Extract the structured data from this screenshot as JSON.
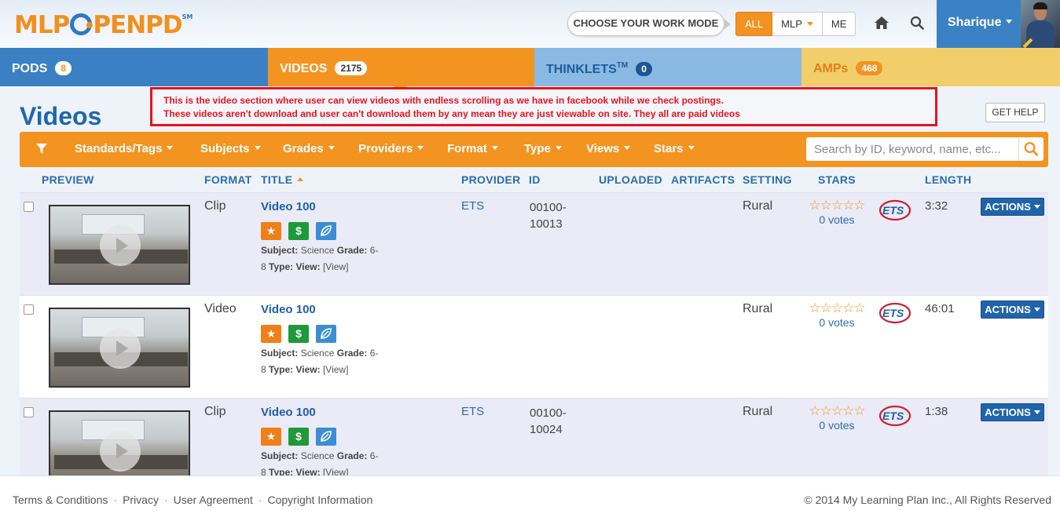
{
  "header": {
    "logo_part1": "MLP",
    "logo_part2": "PENPD",
    "logo_sm": "SM",
    "work_mode_label": "CHOOSE YOUR WORK MODE",
    "modes": [
      "ALL",
      "MLP",
      "ME"
    ],
    "active_mode": "ALL",
    "user_name": "Sharique"
  },
  "tabs": [
    {
      "label": "PODS",
      "count": "8"
    },
    {
      "label": "VIDEOS",
      "count": "2175"
    },
    {
      "label": "THINKLETS",
      "trademark": "TM",
      "count": "0"
    },
    {
      "label": "AMPs",
      "count": "468"
    }
  ],
  "page": {
    "title": "Videos",
    "help_label": "GET HELP",
    "annotation_line1": "This is the video section where user can view videos with endless scrolling as we have in facebook while we check postings.",
    "annotation_line2": "These videos aren't download and user can't download them by any mean they are just viewable on site.  They all are paid videos"
  },
  "filters": {
    "items": [
      "Standards/Tags",
      "Subjects",
      "Grades",
      "Providers",
      "Format",
      "Type",
      "Views",
      "Stars"
    ],
    "search_placeholder": "Search by ID, keyword, name, etc..."
  },
  "table": {
    "columns": [
      "PREVIEW",
      "FORMAT",
      "TITLE",
      "PROVIDER",
      "ID",
      "UPLOADED",
      "ARTIFACTS",
      "SETTING",
      "STARS",
      "LENGTH"
    ],
    "rows": [
      {
        "format": "Clip",
        "title": "Video 100",
        "provider": "ETS",
        "id_line1": "00100-",
        "id_line2": "10013",
        "setting": "Rural",
        "stars": "☆☆☆☆☆",
        "votes": "0 votes",
        "length": "3:32"
      },
      {
        "format": "Video",
        "title": "Video 100",
        "provider": "",
        "id_line1": "",
        "id_line2": "",
        "setting": "Rural",
        "stars": "☆☆☆☆☆",
        "votes": "0 votes",
        "length": "46:01"
      },
      {
        "format": "Clip",
        "title": "Video 100",
        "provider": "ETS",
        "id_line1": "00100-",
        "id_line2": "10024",
        "setting": "Rural",
        "stars": "☆☆☆☆☆",
        "votes": "0 votes",
        "length": "1:38"
      }
    ],
    "meta": {
      "subject_label": "Subject:",
      "subject_value": "Science",
      "grade_label": "Grade:",
      "grade_value": "6-",
      "grade_value2": "8",
      "type_label": "Type:",
      "view_label": "View:",
      "view_value": "[View]"
    },
    "chip_star": "★",
    "chip_paid": "$",
    "actions_label": "ACTIONS",
    "provider_logo_text": "ETS"
  },
  "footer": {
    "links": [
      "Terms & Conditions",
      "Privacy",
      "User Agreement",
      "Copyright Information"
    ],
    "separator": "·",
    "copyright": "© 2014 My Learning Plan Inc., All Rights Reserved"
  },
  "colors": {
    "orange": "#f39421",
    "blue": "#3a80c2",
    "light_blue": "#8ab9e3",
    "yellow": "#f2ce6a",
    "annotation_red": "#e8121f"
  }
}
